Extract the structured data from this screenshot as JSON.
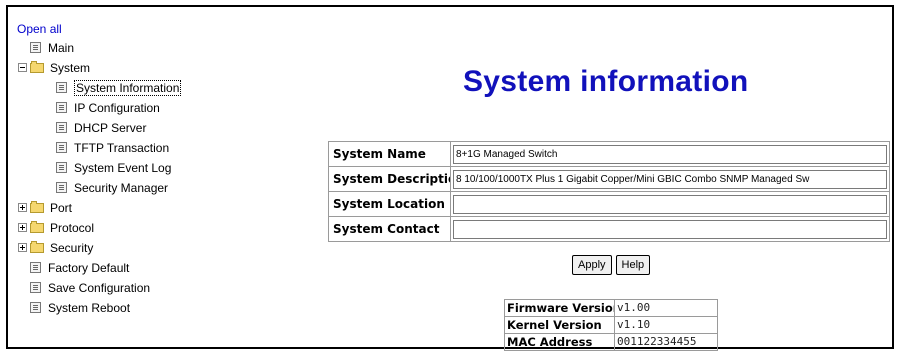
{
  "tree": {
    "open_all": "Open all",
    "items": [
      {
        "label": "Main",
        "type": "doc",
        "level": 1
      },
      {
        "label": "System",
        "type": "folder-open",
        "level": 1
      },
      {
        "label": "System Information",
        "type": "doc",
        "level": 2,
        "selected": true
      },
      {
        "label": "IP Configuration",
        "type": "doc",
        "level": 2
      },
      {
        "label": "DHCP Server",
        "type": "doc",
        "level": 2
      },
      {
        "label": "TFTP Transaction",
        "type": "doc",
        "level": 2
      },
      {
        "label": "System Event Log",
        "type": "doc",
        "level": 2
      },
      {
        "label": "Security Manager",
        "type": "doc",
        "level": 2
      },
      {
        "label": "Port",
        "type": "folder",
        "level": 1
      },
      {
        "label": "Protocol",
        "type": "folder",
        "level": 1
      },
      {
        "label": "Security",
        "type": "folder",
        "level": 1
      },
      {
        "label": "Factory Default",
        "type": "doc",
        "level": 1
      },
      {
        "label": "Save Configuration",
        "type": "doc",
        "level": 1
      },
      {
        "label": "System Reboot",
        "type": "doc",
        "level": 1
      }
    ]
  },
  "page": {
    "title": "System information"
  },
  "form": {
    "rows": [
      {
        "label": "System Name",
        "value": "8+1G Managed Switch"
      },
      {
        "label": "System Description",
        "value": "8 10/100/1000TX Plus 1 Gigabit Copper/Mini GBIC Combo SNMP Managed Sw"
      },
      {
        "label": "System Location",
        "value": ""
      },
      {
        "label": "System Contact",
        "value": ""
      }
    ],
    "apply_label": "Apply",
    "help_label": "Help"
  },
  "info": {
    "rows": [
      {
        "label": "Firmware Version",
        "value": "v1.00"
      },
      {
        "label": "Kernel Version",
        "value": "v1.10"
      },
      {
        "label": "MAC Address",
        "value": "001122334455"
      }
    ]
  },
  "colors": {
    "title": "#1111bb",
    "link": "#0000cc"
  }
}
